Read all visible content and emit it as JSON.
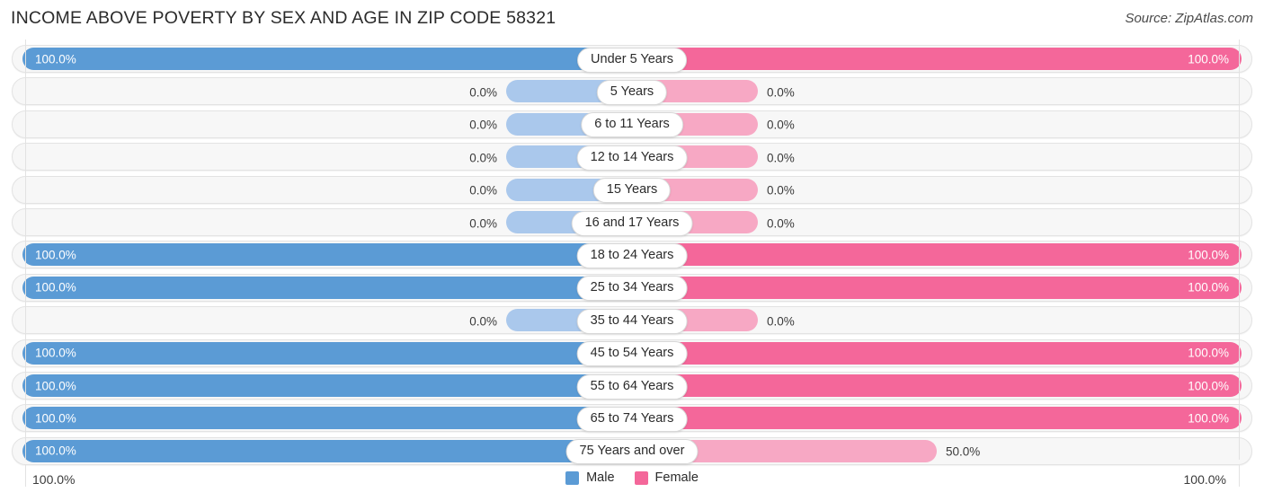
{
  "header": {
    "title": "INCOME ABOVE POVERTY BY SEX AND AGE IN ZIP CODE 58321",
    "source": "Source: ZipAtlas.com"
  },
  "legend": {
    "male_label": "Male",
    "female_label": "Female",
    "male_color": "#5b9bd5",
    "female_color": "#f4679a"
  },
  "axis": {
    "left_label": "100.0%",
    "right_label": "100.0%"
  },
  "colors": {
    "male_full": "#5b9bd5",
    "male_light": "#aac8ec",
    "female_full": "#f4679a",
    "female_light": "#f7a8c4",
    "track": "#f7f7f7",
    "track_border": "#e3e3e3"
  },
  "chart_data": {
    "type": "bar",
    "title": "INCOME ABOVE POVERTY BY SEX AND AGE IN ZIP CODE 58321",
    "subtitle": "Source: ZipAtlas.com",
    "orientation": "horizontal-diverging",
    "xlabel": "",
    "ylabel": "",
    "xlim": [
      0,
      100
    ],
    "grid": false,
    "legend_position": "bottom-center",
    "categories": [
      "Under 5 Years",
      "5 Years",
      "6 to 11 Years",
      "12 to 14 Years",
      "15 Years",
      "16 and 17 Years",
      "18 to 24 Years",
      "25 to 34 Years",
      "35 to 44 Years",
      "45 to 54 Years",
      "55 to 64 Years",
      "65 to 74 Years",
      "75 Years and over"
    ],
    "series": [
      {
        "name": "Male",
        "values": [
          100.0,
          0.0,
          0.0,
          0.0,
          0.0,
          0.0,
          100.0,
          100.0,
          0.0,
          100.0,
          100.0,
          100.0,
          100.0
        ]
      },
      {
        "name": "Female",
        "values": [
          100.0,
          0.0,
          0.0,
          0.0,
          0.0,
          0.0,
          100.0,
          100.0,
          0.0,
          100.0,
          100.0,
          100.0,
          50.0
        ]
      }
    ],
    "rows": [
      {
        "label": "Under 5 Years",
        "male": 100.0,
        "female": 100.0,
        "male_text": "100.0%",
        "female_text": "100.0%"
      },
      {
        "label": "5 Years",
        "male": 0.0,
        "female": 0.0,
        "male_text": "0.0%",
        "female_text": "0.0%"
      },
      {
        "label": "6 to 11 Years",
        "male": 0.0,
        "female": 0.0,
        "male_text": "0.0%",
        "female_text": "0.0%"
      },
      {
        "label": "12 to 14 Years",
        "male": 0.0,
        "female": 0.0,
        "male_text": "0.0%",
        "female_text": "0.0%"
      },
      {
        "label": "15 Years",
        "male": 0.0,
        "female": 0.0,
        "male_text": "0.0%",
        "female_text": "0.0%"
      },
      {
        "label": "16 and 17 Years",
        "male": 0.0,
        "female": 0.0,
        "male_text": "0.0%",
        "female_text": "0.0%"
      },
      {
        "label": "18 to 24 Years",
        "male": 100.0,
        "female": 100.0,
        "male_text": "100.0%",
        "female_text": "100.0%"
      },
      {
        "label": "25 to 34 Years",
        "male": 100.0,
        "female": 100.0,
        "male_text": "100.0%",
        "female_text": "100.0%"
      },
      {
        "label": "35 to 44 Years",
        "male": 0.0,
        "female": 0.0,
        "male_text": "0.0%",
        "female_text": "0.0%"
      },
      {
        "label": "45 to 54 Years",
        "male": 100.0,
        "female": 100.0,
        "male_text": "100.0%",
        "female_text": "100.0%"
      },
      {
        "label": "55 to 64 Years",
        "male": 100.0,
        "female": 100.0,
        "male_text": "100.0%",
        "female_text": "100.0%"
      },
      {
        "label": "65 to 74 Years",
        "male": 100.0,
        "female": 100.0,
        "male_text": "100.0%",
        "female_text": "100.0%"
      },
      {
        "label": "75 Years and over",
        "male": 100.0,
        "female": 50.0,
        "male_text": "100.0%",
        "female_text": "50.0%"
      }
    ]
  }
}
